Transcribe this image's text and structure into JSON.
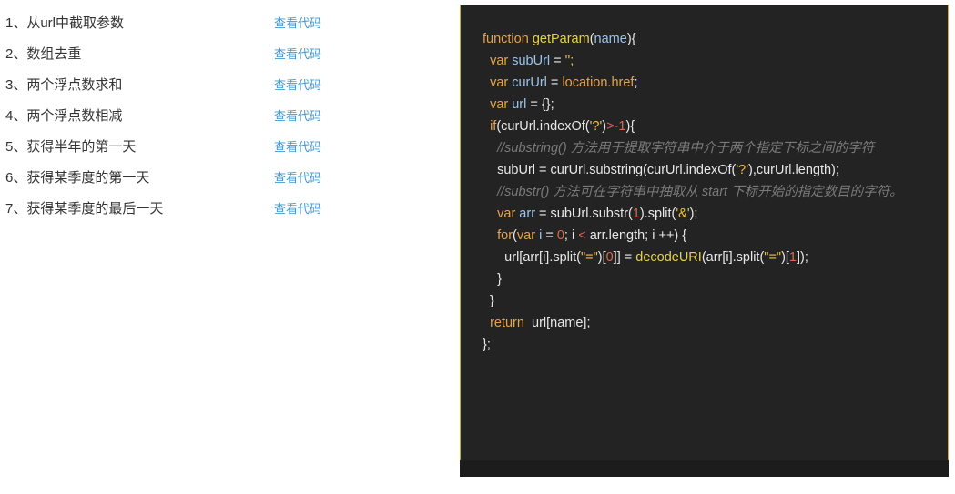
{
  "list": {
    "items": [
      {
        "label": "1、从url中截取参数",
        "link": "查看代码"
      },
      {
        "label": "2、数组去重",
        "link": "查看代码"
      },
      {
        "label": "3、两个浮点数求和",
        "link": "查看代码"
      },
      {
        "label": "4、两个浮点数相减",
        "link": "查看代码"
      },
      {
        "label": "5、获得半年的第一天",
        "link": "查看代码"
      },
      {
        "label": "6、获得某季度的第一天",
        "link": "查看代码"
      },
      {
        "label": "7、获得某季度的最后一天",
        "link": "查看代码"
      }
    ]
  },
  "code": {
    "lines": [
      [
        {
          "c": "kw",
          "t": "function "
        },
        {
          "c": "fn",
          "t": "getParam"
        },
        {
          "c": "pl",
          "t": "("
        },
        {
          "c": "var",
          "t": "name"
        },
        {
          "c": "pl",
          "t": "){"
        }
      ],
      [
        {
          "c": "pl",
          "t": "  "
        },
        {
          "c": "kw",
          "t": "var "
        },
        {
          "c": "var",
          "t": "subUrl"
        },
        {
          "c": "pl",
          "t": " = "
        },
        {
          "c": "str",
          "t": "'';"
        }
      ],
      [
        {
          "c": "pl",
          "t": "  "
        },
        {
          "c": "kw",
          "t": "var "
        },
        {
          "c": "var",
          "t": "curUrl"
        },
        {
          "c": "pl",
          "t": " = "
        },
        {
          "c": "kw",
          "t": "location.href"
        },
        {
          "c": "pl",
          "t": ";"
        }
      ],
      [
        {
          "c": "pl",
          "t": "  "
        },
        {
          "c": "kw",
          "t": "var "
        },
        {
          "c": "var",
          "t": "url"
        },
        {
          "c": "pl",
          "t": " = {};"
        }
      ],
      [
        {
          "c": "pl",
          "t": "  "
        },
        {
          "c": "kw",
          "t": "if"
        },
        {
          "c": "pl",
          "t": "(curUrl.indexOf("
        },
        {
          "c": "str",
          "t": "'?'"
        },
        {
          "c": "pl",
          "t": ")"
        },
        {
          "c": "op",
          "t": ">-"
        },
        {
          "c": "num",
          "t": "1"
        },
        {
          "c": "pl",
          "t": "){"
        }
      ],
      [
        {
          "c": "pl",
          "t": "    "
        },
        {
          "c": "cm",
          "t": "//substring() 方法用于提取字符串中介于两个指定下标之间的字符"
        }
      ],
      [
        {
          "c": "pl",
          "t": "    subUrl = curUrl.substring(curUrl.indexOf("
        },
        {
          "c": "str",
          "t": "'?'"
        },
        {
          "c": "pl",
          "t": "),curUrl.length);"
        }
      ],
      [
        {
          "c": "pl",
          "t": "    "
        },
        {
          "c": "cm",
          "t": "//substr() 方法可在字符串中抽取从 start 下标开始的指定数目的字符。"
        }
      ],
      [
        {
          "c": "pl",
          "t": "    "
        },
        {
          "c": "kw",
          "t": "var "
        },
        {
          "c": "var",
          "t": "arr"
        },
        {
          "c": "pl",
          "t": " = subUrl.substr("
        },
        {
          "c": "num",
          "t": "1"
        },
        {
          "c": "pl",
          "t": ").split("
        },
        {
          "c": "str",
          "t": "'&'"
        },
        {
          "c": "pl",
          "t": ");"
        }
      ],
      [
        {
          "c": "pl",
          "t": "    "
        },
        {
          "c": "kw",
          "t": "for"
        },
        {
          "c": "pl",
          "t": "("
        },
        {
          "c": "kw",
          "t": "var "
        },
        {
          "c": "var",
          "t": "i"
        },
        {
          "c": "pl",
          "t": " = "
        },
        {
          "c": "num",
          "t": "0"
        },
        {
          "c": "pl",
          "t": "; i "
        },
        {
          "c": "op",
          "t": "<"
        },
        {
          "c": "pl",
          "t": " arr.length; i ++) {"
        }
      ],
      [
        {
          "c": "pl",
          "t": "      url[arr[i].split("
        },
        {
          "c": "str",
          "t": "\"=\""
        },
        {
          "c": "pl",
          "t": ")["
        },
        {
          "c": "num",
          "t": "0"
        },
        {
          "c": "pl",
          "t": "]] = "
        },
        {
          "c": "fn",
          "t": "decodeURI"
        },
        {
          "c": "pl",
          "t": "(arr[i].split("
        },
        {
          "c": "str",
          "t": "\"=\""
        },
        {
          "c": "pl",
          "t": ")["
        },
        {
          "c": "num",
          "t": "1"
        },
        {
          "c": "pl",
          "t": "]);"
        }
      ],
      [
        {
          "c": "pl",
          "t": "    }"
        }
      ],
      [
        {
          "c": "pl",
          "t": "  }"
        }
      ],
      [
        {
          "c": "pl",
          "t": "  "
        },
        {
          "c": "kw",
          "t": "return"
        },
        {
          "c": "pl",
          "t": "  url[name];"
        }
      ],
      [
        {
          "c": "pl",
          "t": "};"
        }
      ]
    ]
  },
  "colors": {
    "link": "#3c9ad6",
    "panel_bg": "#232323",
    "panel_border": "#e2a535"
  }
}
